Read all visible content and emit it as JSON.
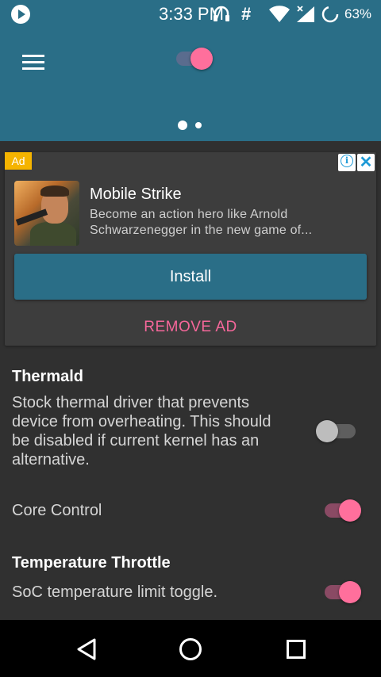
{
  "status_bar": {
    "time": "3:33 PM",
    "battery_percent": "63%",
    "icons": [
      "play-icon",
      "headphones-icon",
      "hash-icon",
      "wifi-icon",
      "signal-icon",
      "battery-icon"
    ]
  },
  "toolbar": {
    "master_switch_on": true,
    "page_indicator": {
      "count": 2,
      "active": 0
    }
  },
  "ad": {
    "badge": "Ad",
    "title": "Mobile Strike",
    "description": "Become an action hero like Arnold Schwarzenegger in the new game of...",
    "install_label": "Install",
    "remove_label": "REMOVE AD"
  },
  "settings": [
    {
      "title": "Thermald",
      "description": "Stock thermal driver that prevents device from overheating. This should be disabled if current kernel has an alternative.",
      "enabled": false
    },
    {
      "title": "",
      "description": "Core Control",
      "enabled": true
    },
    {
      "title": "Temperature Throttle",
      "description": "SoC temperature limit toggle.",
      "enabled": true
    }
  ],
  "colors": {
    "primary": "#2a6e87",
    "accent": "#ff6f9c",
    "background": "#303030"
  }
}
